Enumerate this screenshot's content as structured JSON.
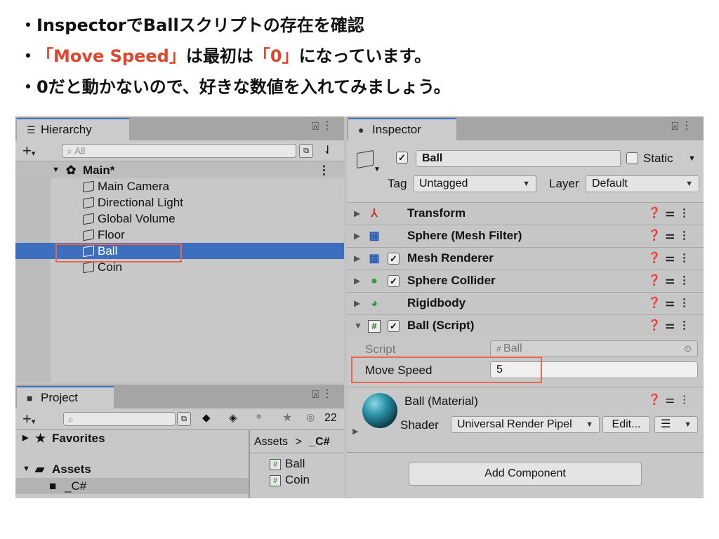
{
  "slide": {
    "bullet_dot": "・",
    "line1": "InspectorでBallスクリプトの存在を確認",
    "line2_highlight1": "「Move Speed」",
    "line2_mid": "は最初は",
    "line2_highlight2": "「0」",
    "line2_end": "になっています。",
    "line3": "0だと動かないので、好きな数値を入れてみましょう。"
  },
  "hierarchy": {
    "tab_label": "Hierarchy",
    "search_placeholder": "All",
    "scene": "Main*",
    "items": [
      "Main Camera",
      "Directional Light",
      "Global Volume",
      "Floor",
      "Ball",
      "Coin"
    ],
    "selected_item": "Ball"
  },
  "project": {
    "tab_label": "Project",
    "hidden_count": "22",
    "favorites_label": "Favorites",
    "assets_label": "Assets",
    "folder_c": "_C#",
    "breadcrumb_root": "Assets",
    "breadcrumb_sep": ">",
    "breadcrumb_current": "_C#",
    "files": [
      "Ball",
      "Coin"
    ]
  },
  "inspector": {
    "tab_label": "Inspector",
    "object_name": "Ball",
    "static_label": "Static",
    "tag_label": "Tag",
    "tag_value": "Untagged",
    "layer_label": "Layer",
    "layer_value": "Default",
    "components": [
      {
        "name": "Transform",
        "icon": "transform-icon",
        "checkbox": false
      },
      {
        "name": "Sphere (Mesh Filter)",
        "icon": "mesh-filter-icon",
        "checkbox": false
      },
      {
        "name": "Mesh Renderer",
        "icon": "mesh-renderer-icon",
        "checkbox": true
      },
      {
        "name": "Sphere Collider",
        "icon": "sphere-collider-icon",
        "checkbox": true
      },
      {
        "name": "Rigidbody",
        "icon": "rigidbody-icon",
        "checkbox": false
      },
      {
        "name": "Ball (Script)",
        "icon": "script-icon",
        "checkbox": true
      }
    ],
    "script_label": "Script",
    "script_value": "Ball",
    "move_speed_label": "Move Speed",
    "move_speed_value": "5",
    "material_name": "Ball (Material)",
    "shader_label": "Shader",
    "shader_value": "Universal Render Pipel",
    "edit_button": "Edit...",
    "add_component": "Add Component"
  },
  "colors": {
    "accent_red": "#e0452c",
    "highlight_box": "#e9654c",
    "selection_blue": "#3d6fbf"
  }
}
